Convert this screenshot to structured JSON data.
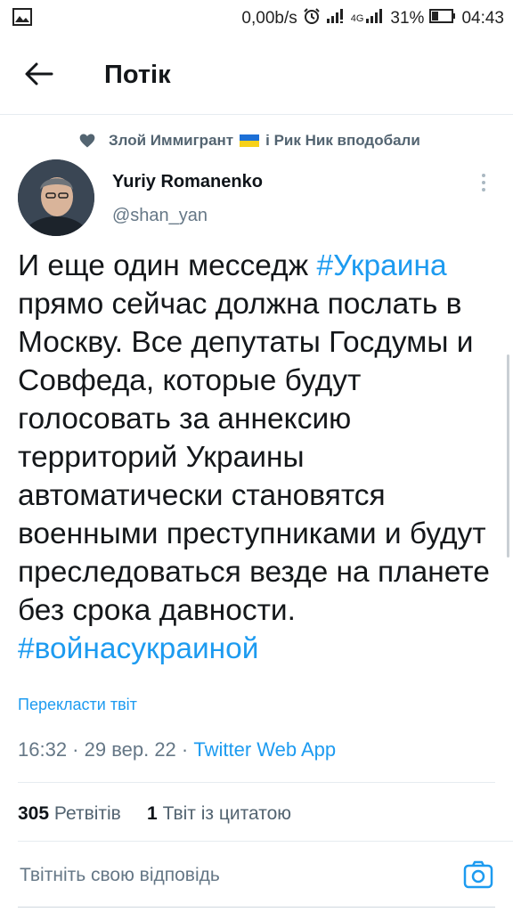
{
  "status_bar": {
    "net_speed": "0,00b/s",
    "signal_label": "4G",
    "battery_pct": "31%",
    "time": "04:43"
  },
  "header": {
    "title": "Потік"
  },
  "social_context": {
    "user1": "Злой Иммигрант",
    "rest": "і Рик Ник вподобали"
  },
  "tweet": {
    "author_name": "Yuriy Romanenko",
    "author_handle": "@shan_yan",
    "text_1": "И еще один месседж ",
    "hashtag_1": "#Украина",
    "text_2": " прямо сейчас должна послать в Москву. Все депутаты Госдумы и Совфеда, которые будут голосовать за аннексию территорий Украины автоматически становятся военными преступниками и будут преследоваться везде на планете без срока давности.",
    "hashtag_2": "#войнасукраиной",
    "translate_label": "Перекласти твіт",
    "time_date": "16:32 · 29 вер. 22 · ",
    "source": "Twitter Web App",
    "retweets_count": "305",
    "retweets_label": "Ретвітів",
    "quotes_count": "1",
    "quotes_label": "Твіт із цитатою"
  },
  "reply": {
    "placeholder": "Твітніть свою відповідь"
  },
  "colors": {
    "accent": "#1d9bf0",
    "text": "#0f1419",
    "secondary": "#657786",
    "divider": "#e6ecf0"
  }
}
